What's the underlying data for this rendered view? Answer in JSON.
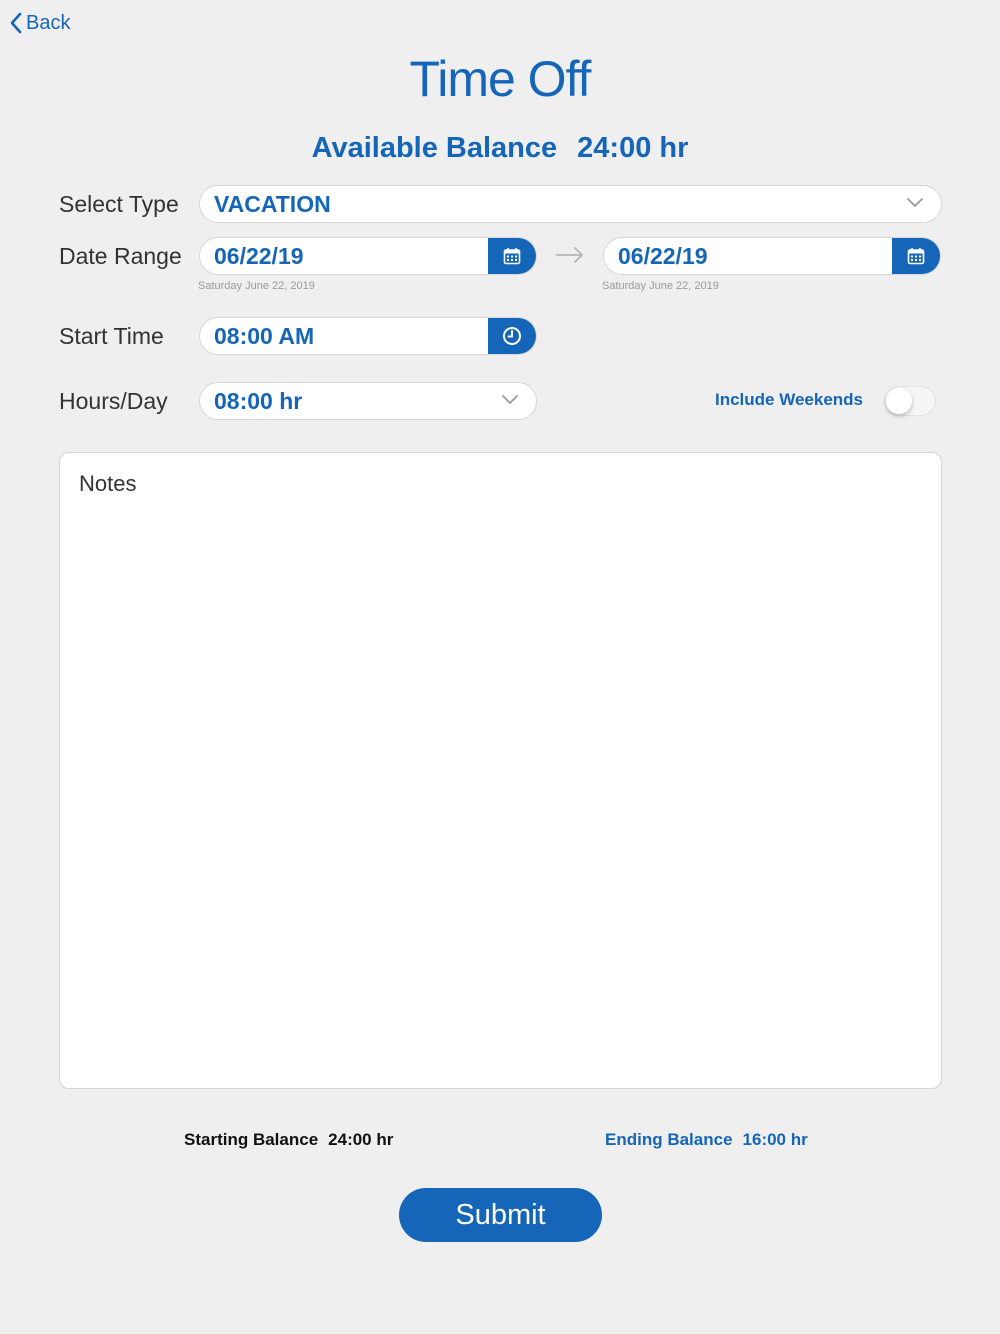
{
  "nav": {
    "back_label": "Back"
  },
  "page": {
    "title": "Time Off"
  },
  "balance": {
    "label": "Available Balance",
    "value": "24:00 hr"
  },
  "form": {
    "type": {
      "label": "Select Type",
      "value": "VACATION"
    },
    "date_range": {
      "label": "Date Range",
      "start": {
        "value": "06/22/19",
        "caption": "Saturday June 22, 2019"
      },
      "end": {
        "value": "06/22/19",
        "caption": "Saturday June 22, 2019"
      }
    },
    "start_time": {
      "label": "Start Time",
      "value": "08:00 AM"
    },
    "hours_per_day": {
      "label": "Hours/Day",
      "value": "08:00 hr"
    },
    "include_weekends": {
      "label": "Include Weekends",
      "enabled": false
    },
    "notes": {
      "placeholder": "Notes"
    }
  },
  "summary": {
    "starting_label": "Starting Balance",
    "starting_value": "24:00 hr",
    "ending_label": "Ending Balance",
    "ending_value": "16:00 hr"
  },
  "actions": {
    "submit_label": "Submit"
  },
  "colors": {
    "accent": "#1565b8",
    "background": "#efefef"
  },
  "icons": [
    "chevron-left-icon",
    "chevron-down-icon",
    "calendar-icon",
    "clock-icon",
    "arrow-right-icon"
  ]
}
